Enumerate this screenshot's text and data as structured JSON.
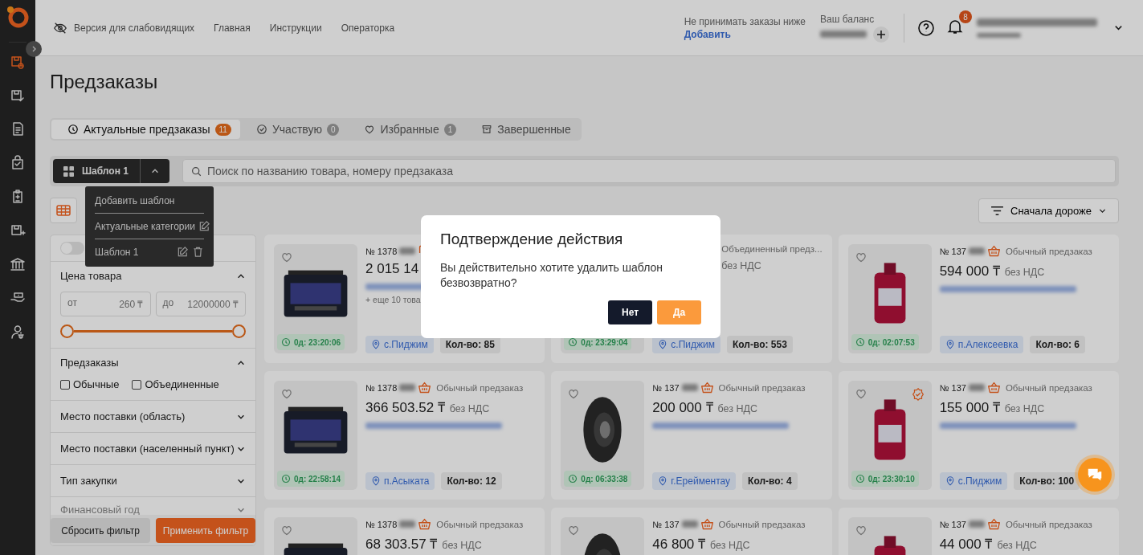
{
  "sidebar": {
    "items": [
      {
        "selected": true
      },
      {
        "selected": false
      },
      {
        "selected": false
      },
      {
        "selected": false
      },
      {
        "selected": false
      },
      {
        "selected": false
      },
      {
        "selected": false
      },
      {
        "selected": false
      },
      {
        "selected": false
      }
    ]
  },
  "header": {
    "accessibility": "Версия для слабовидящих",
    "nav": [
      "Главная",
      "Инструкции",
      "Операторка"
    ],
    "min_order": {
      "label": "Не принимать заказы ниже",
      "link": "Добавить"
    },
    "balance": {
      "label": "Ваш баланс"
    },
    "notifications": "8"
  },
  "title": "Предзаказы",
  "tabs": [
    {
      "label": "Актуальные предзаказы",
      "count": "11",
      "selected": true
    },
    {
      "label": "Участвую",
      "count": "0",
      "selected": false
    },
    {
      "label": "Избранные",
      "count": "1",
      "selected": false
    },
    {
      "label": "Завершенные",
      "selected": false
    }
  ],
  "template_button": "Шаблон 1",
  "search": {
    "placeholder": "Поиск по названию товара, номеру предзаказа"
  },
  "template_menu": [
    {
      "label": "Добавить шаблон",
      "kind": "action"
    },
    {
      "label": "Актуальные категории",
      "kind": "editable"
    },
    {
      "label": "Шаблон 1",
      "kind": "template"
    }
  ],
  "view": {
    "selected": true
  },
  "sort": "Сначала дороже",
  "filter": {
    "toggle": {
      "on": false
    },
    "price": {
      "title": "Цена товара",
      "expanded": true,
      "from_label": "от",
      "from": "260 ₸",
      "to_label": "до",
      "to": "12000000 ₸"
    },
    "preorders": {
      "title": "Предзаказы",
      "expanded": true,
      "options": [
        {
          "label": "Обычные",
          "checked": false
        },
        {
          "label": "Объединенные",
          "checked": false
        }
      ]
    },
    "sections": [
      {
        "title": "Место поставки (область)",
        "expanded": false
      },
      {
        "title": "Место поставки (населенный пункт)",
        "expanded": false
      },
      {
        "title": "Тип закупки",
        "expanded": false
      },
      {
        "title": "Финансовый год",
        "expanded": false
      }
    ],
    "reset": "Сбросить фильтр",
    "apply": "Применить фильтр"
  },
  "cards": [
    {
      "number": "№ 1378",
      "kind": "merged",
      "price": "2 015 14",
      "extra": "+ еще 10 това",
      "timer": "0д: 23:20:06",
      "location": "с.Пиджим",
      "qty": "Кол-во: 85",
      "favorite": false
    },
    {
      "type_label": "Объединенный предз...",
      "vat": "без НДС",
      "timer": "0д: 23:29:04",
      "location": "с.Пиджим",
      "qty": "Кол-во: 553"
    },
    {
      "number": "№ 137",
      "kind": "regular",
      "type_label": "Обычный предзаказ",
      "price": "594 000 ₸",
      "vat": "без НДС",
      "timer": "0д: 02:07:53",
      "location": "п.Алексеевка",
      "qty": "Кол-во: 6",
      "favorite": false,
      "verified": false
    },
    {
      "number": "№ 1378",
      "kind": "regular",
      "type_label": "Обычный предзаказ",
      "price": "366 503.52 ₸",
      "vat": "без НДС",
      "timer": "0д: 22:58:14",
      "location": "п.Асыката",
      "qty": "Кол-во: 12",
      "favorite": false,
      "verified": false
    },
    {
      "number": "№ 137",
      "kind": "regular",
      "type_label": "Обычный предзаказ",
      "price": "200 000 ₸",
      "vat": "без НДС",
      "timer": "0д: 06:33:38",
      "location": "г.Ерейментау",
      "qty": "Кол-во: 4",
      "favorite": false,
      "verified": false
    },
    {
      "number": "№ 137",
      "kind": "regular",
      "type_label": "Обычный предзаказ",
      "price": "155 000 ₸",
      "vat": "без НДС",
      "timer": "0д: 23:30:10",
      "location": "с.Пиджим",
      "qty": "Кол-во: 100",
      "favorite": false,
      "verified": true
    },
    {
      "number": "№ 1378",
      "kind": "regular",
      "type_label": "Обычный предзаказ",
      "price": "68 303.57 ₸",
      "vat": "без НДС",
      "favorite": false,
      "verified": false
    },
    {
      "number": "№ 137",
      "kind": "regular",
      "type_label": "Обычный предзаказ",
      "price": "46 800 ₸",
      "vat": "без НДС",
      "favorite": false,
      "verified": false
    },
    {
      "number": "№ 137",
      "kind": "regular",
      "type_label": "Обычный предзаказ",
      "price": "44 000 ₸",
      "vat": "без НДС",
      "favorite": false,
      "verified": false
    }
  ],
  "modal": {
    "title": "Подтверждение действия",
    "text": "Вы действительно хотите удалить шаблон безвозвратно?",
    "buttons": [
      {
        "label": "Нет",
        "kind": "secondary"
      },
      {
        "label": "Да",
        "kind": "primary"
      }
    ]
  }
}
